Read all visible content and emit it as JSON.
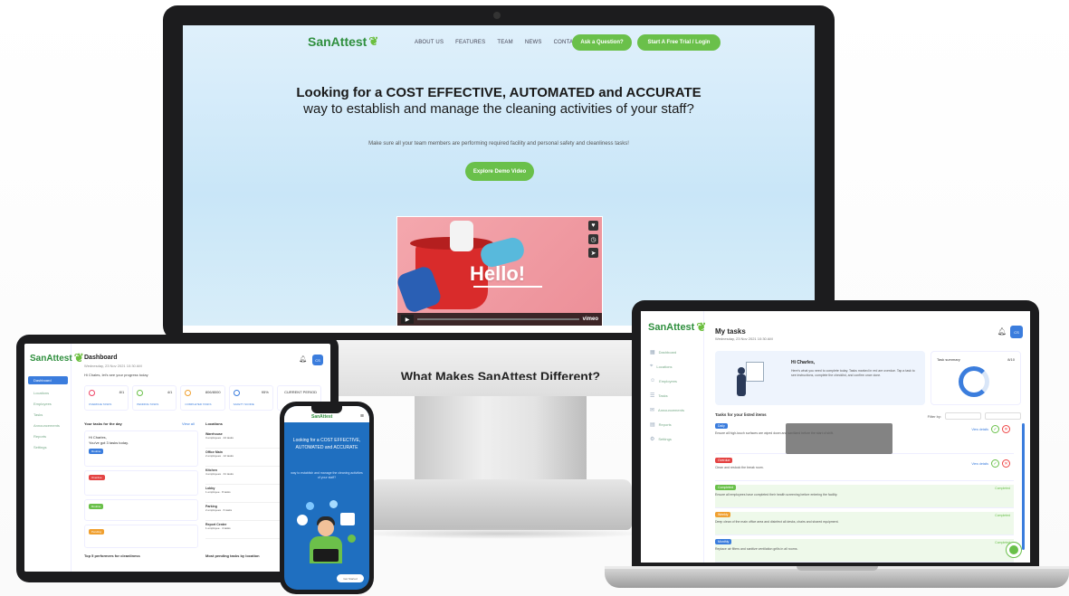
{
  "brand": {
    "name": "SanAttest",
    "green": "#6ac04a",
    "blue": "#3b7ddd",
    "dark": "#1c1c1e"
  },
  "monitor": {
    "nav": [
      "ABOUT US",
      "FEATURES",
      "TEAM",
      "NEWS",
      "CONTACT US"
    ],
    "ask_button": "Ask a Question?",
    "trial_button": "Start A Free Trial / Login",
    "headline_1": "Looking for a COST EFFECTIVE, AUTOMATED and ACCURATE",
    "headline_2": "way to establish and manage the cleaning activities of your staff?",
    "subtext": "Make sure all your team members are performing required facility and personal safety and cleanliness tasks!",
    "cta": "Explore Demo Video",
    "video_text": "Hello!",
    "video_brand": "vimeo",
    "section_heading": "What Makes SanAttest Different?"
  },
  "tablet": {
    "sidebar": [
      "Dashboard",
      "Locations",
      "Employees",
      "Tasks",
      "Announcements",
      "Reports",
      "Settings"
    ],
    "title": "Dashboard",
    "subtitle": "Wednesday, 23 Nov 2021 10:30 AM",
    "greeting": "Hi Chales, let's see your progress today",
    "stats": [
      {
        "num": "8/1",
        "lbl": "OVERDUE TASKS"
      },
      {
        "num": "4/1",
        "lbl": "PENDING TASKS"
      },
      {
        "num": "806/8000",
        "lbl": "COMPLETED TASKS"
      },
      {
        "num": "95%",
        "lbl": "SAFETY SCORE"
      },
      {
        "num": "CURRENT PERIOD",
        "lbl": ""
      }
    ],
    "col_tasks": "Your tasks for the day",
    "col_view_all": "View all",
    "col_locations": "Locations",
    "card_title": "Hi Charles,",
    "card_text": "You've got 3 tasks today.",
    "tag_overdue": "Overdue",
    "tag_routine": "Routine",
    "tag_pending": "Pending",
    "locations": [
      {
        "name": "Warehouse",
        "meta": "3 employees · 24 tasks"
      },
      {
        "name": "Office Main",
        "meta": "2 employees · 12 tasks"
      },
      {
        "name": "Kitchen",
        "meta": "4 employees · 31 tasks"
      },
      {
        "name": "Lobby",
        "meta": "1 employee · 8 tasks"
      },
      {
        "name": "Parking",
        "meta": "2 employees · 6 tasks"
      },
      {
        "name": "Report Center",
        "meta": "1 employee · 4 tasks"
      }
    ],
    "bottom_left": "Top 5 performers for cleanliness",
    "bottom_right": "Most pending tasks by location"
  },
  "phone": {
    "logo": "SanAttest",
    "headline": "Looking for a COST EFFECTIVE, AUTOMATED and ACCURATE",
    "sub": "way to establish and manage the cleaning activities of your staff?",
    "button": "Get Started"
  },
  "laptop": {
    "sidebar": [
      "Dashboard",
      "Locations",
      "Employees",
      "Tasks",
      "Announcements",
      "Reports",
      "Settings"
    ],
    "title": "My tasks",
    "date": "Wednesday, 23 Nov 2021 10:30 AM",
    "hi": "Hi Charles,",
    "hello_text": "Here's what you need to complete today. Tasks marked in red are overdue. Tap a task to see instructions, complete the checklist, and confirm once done.",
    "summary_title": "Task summary",
    "summary_value": "8/10",
    "list_heading": "Tasks for your listed items",
    "filter_label": "Filter by:",
    "tasks": [
      {
        "tag": "Daily",
        "color": "#3b7ddd",
        "desc": "Ensure all high-touch surfaces are wiped down and sanitized before the start of shift.",
        "link": "View details"
      },
      {
        "tag": "Overdue",
        "color": "#e44444",
        "desc": "Clean and restock the break room.",
        "link": "View details"
      },
      {
        "tag": "Completed",
        "color": "#6ac04a",
        "desc": "Ensure all employees have completed their health screening before entering the facility.",
        "link": "Completed"
      },
      {
        "tag": "Weekly",
        "color": "#f0a030",
        "desc": "Deep clean of the main office area and disinfect all desks, chairs and shared equipment.",
        "link": "Completed"
      },
      {
        "tag": "Monthly",
        "color": "#3b7ddd",
        "desc": "Replace air filters and sanitize ventilation grills in all rooms.",
        "link": "Completed"
      }
    ]
  }
}
